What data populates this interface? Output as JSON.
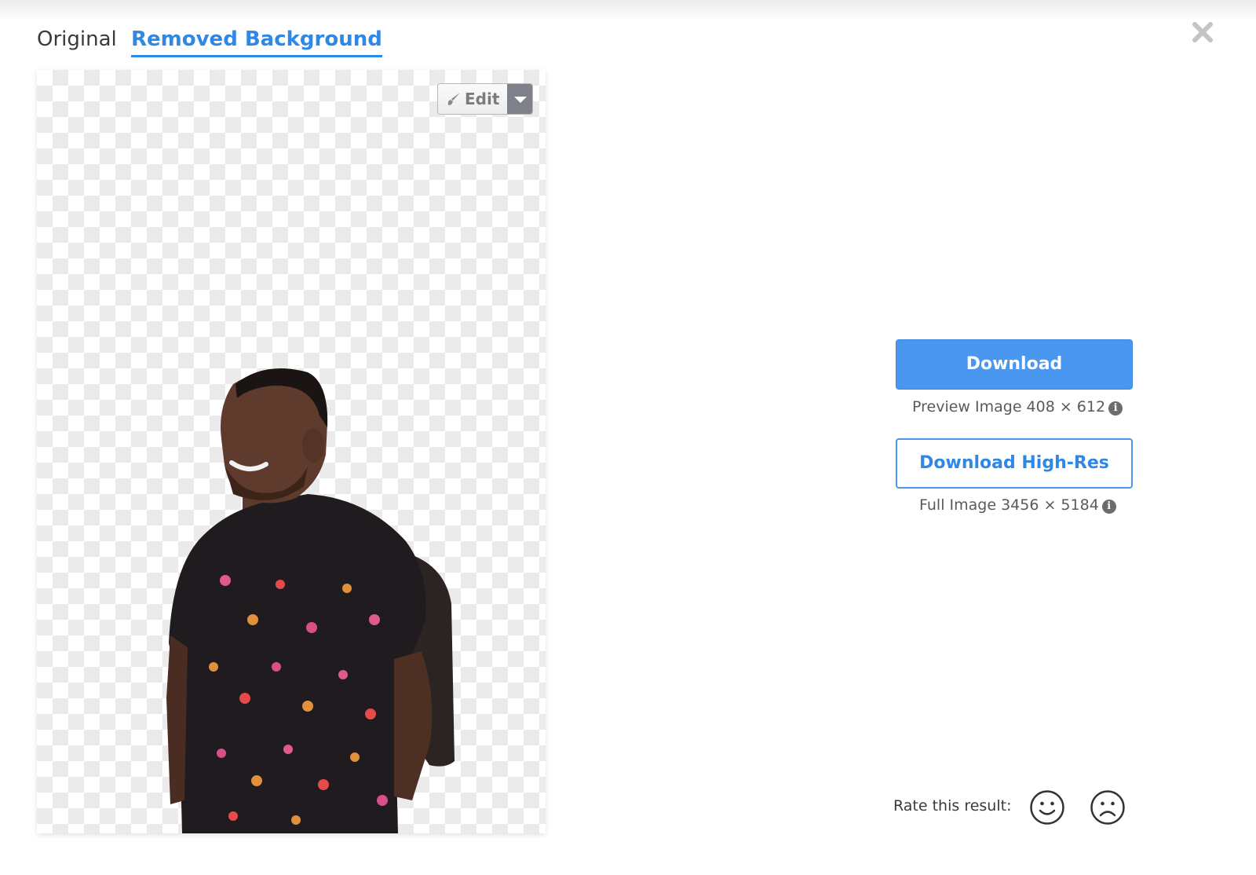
{
  "tabs": [
    {
      "label": "Original",
      "active": false
    },
    {
      "label": "Removed Background",
      "active": true
    }
  ],
  "accent_color": "#2f87e6",
  "close": {
    "icon": "close-icon"
  },
  "editor": {
    "edit_label": "Edit",
    "edit_icon": "brush-icon",
    "dropdown_icon": "caret-down-icon"
  },
  "preview": {
    "background": "transparency-checkerboard",
    "subject": "smiling man in dark patterned short-sleeve shirt with backpack"
  },
  "download": {
    "primary_label": "Download",
    "preview_caption": "Preview Image 408 × 612",
    "highres_label": "Download High-Res",
    "full_caption": "Full Image 3456 × 5184",
    "info_icon": "info-icon"
  },
  "rating": {
    "label": "Rate this result:",
    "options": [
      "smiley-face-icon",
      "sad-face-icon"
    ]
  }
}
